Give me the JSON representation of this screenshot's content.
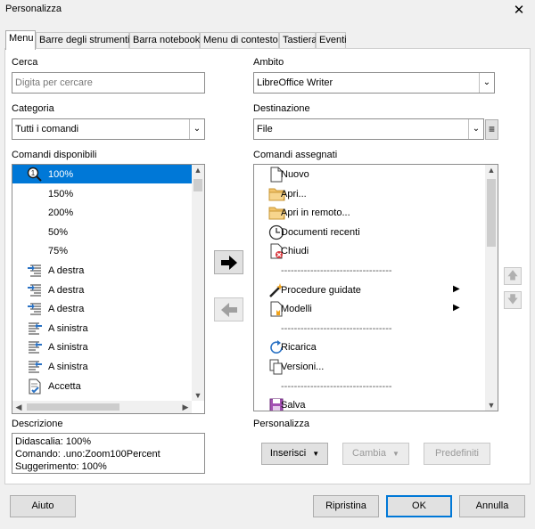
{
  "window": {
    "title": "Personalizza",
    "close": "✕"
  },
  "tabs": [
    "Menu",
    "Barre degli strumenti",
    "Barra notebook",
    "Menu di contesto",
    "Tastiera",
    "Eventi"
  ],
  "search": {
    "label": "Cerca",
    "placeholder": "Digita per cercare",
    "value": ""
  },
  "category": {
    "label": "Categoria",
    "value": "Tutti i comandi"
  },
  "scope": {
    "label": "Ambito",
    "value": "LibreOffice Writer"
  },
  "target": {
    "label": "Destinazione",
    "value": "File"
  },
  "available": {
    "label": "Comandi disponibili",
    "items": [
      {
        "label": "100%",
        "icon": "zoom-100-icon",
        "selected": true
      },
      {
        "label": "150%",
        "icon": ""
      },
      {
        "label": "200%",
        "icon": ""
      },
      {
        "label": "50%",
        "icon": ""
      },
      {
        "label": "75%",
        "icon": ""
      },
      {
        "label": "A destra",
        "icon": "align-right-icon"
      },
      {
        "label": "A destra",
        "icon": "align-right-icon"
      },
      {
        "label": "A destra",
        "icon": "align-right-icon"
      },
      {
        "label": "A sinistra",
        "icon": "align-left-icon"
      },
      {
        "label": "A sinistra",
        "icon": "align-left-icon"
      },
      {
        "label": "A sinistra",
        "icon": "align-left-icon"
      },
      {
        "label": "Accetta",
        "icon": "accept-icon"
      }
    ]
  },
  "assigned": {
    "label": "Comandi assegnati",
    "items": [
      {
        "label": "Nuovo",
        "icon": "new-document-icon"
      },
      {
        "label": "Apri...",
        "icon": "folder-icon"
      },
      {
        "label": "Apri in remoto...",
        "icon": "folder-icon"
      },
      {
        "label": "Documenti recenti",
        "icon": "clock-icon"
      },
      {
        "label": "Chiudi",
        "icon": "close-document-icon"
      },
      {
        "label": "----------------------------------",
        "icon": ""
      },
      {
        "label": "Procedure guidate",
        "icon": "wizard-icon",
        "submenu": true
      },
      {
        "label": "Modelli",
        "icon": "templates-icon",
        "submenu": true
      },
      {
        "label": "----------------------------------",
        "icon": ""
      },
      {
        "label": "Ricarica",
        "icon": "reload-icon"
      },
      {
        "label": "Versioni...",
        "icon": "versions-icon"
      },
      {
        "label": "----------------------------------",
        "icon": ""
      },
      {
        "label": "Salva",
        "icon": "save-icon"
      }
    ]
  },
  "description": {
    "label": "Descrizione",
    "lines": [
      "Didascalia: 100%",
      "Comando: .uno:Zoom100Percent",
      "Suggerimento: 100%"
    ]
  },
  "customize": {
    "label": "Personalizza",
    "insert": "Inserisci",
    "modify": "Cambia",
    "defaults": "Predefiniti"
  },
  "footer": {
    "help": "Aiuto",
    "reset": "Ripristina",
    "ok": "OK",
    "cancel": "Annulla"
  },
  "colors": {
    "selection": "#0078d7",
    "arrow_active": "#000000",
    "arrow_inactive": "#a0a0a0"
  }
}
